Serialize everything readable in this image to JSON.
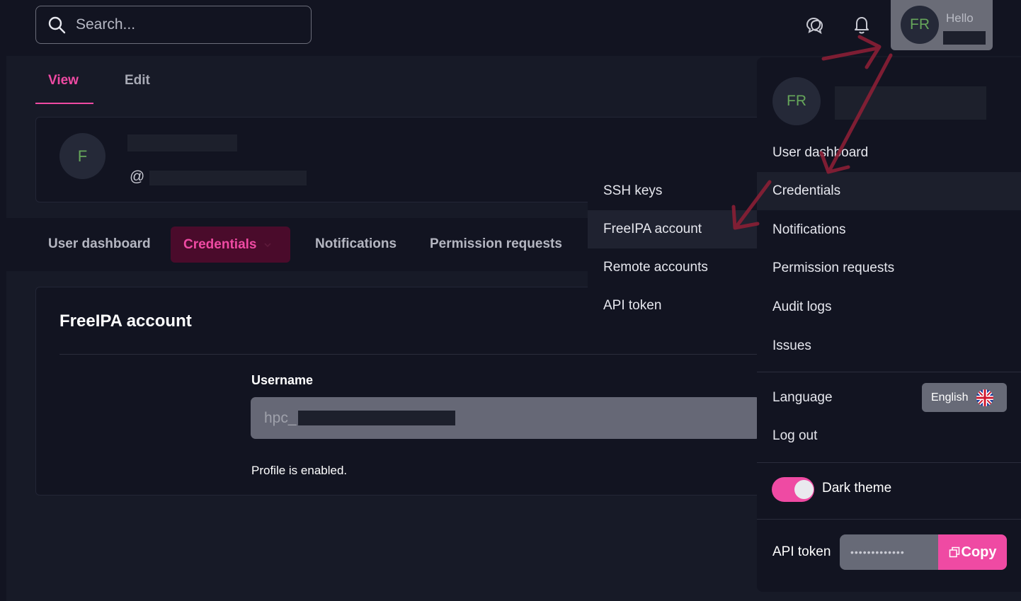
{
  "search": {
    "placeholder": "Search..."
  },
  "header": {
    "hello": "Hello",
    "avatar_initials": "FR"
  },
  "view_tabs": [
    {
      "label": "View",
      "active": true
    },
    {
      "label": "Edit",
      "active": false
    }
  ],
  "profile": {
    "avatar_initial": "F",
    "at_symbol": "@"
  },
  "subnav": [
    {
      "label": "User dashboard"
    },
    {
      "label": "Credentials",
      "active": true
    },
    {
      "label": "Notifications"
    },
    {
      "label": "Permission requests"
    }
  ],
  "submenu": [
    {
      "label": "SSH keys"
    },
    {
      "label": "FreeIPA account",
      "highlighted": true
    },
    {
      "label": "Remote accounts"
    },
    {
      "label": "API token"
    }
  ],
  "content": {
    "title": "FreeIPA account",
    "username_label": "Username",
    "username_prefix": "hpc_",
    "status": "Profile is enabled."
  },
  "dropdown": {
    "avatar_initials": "FR",
    "items": [
      {
        "label": "User dashboard"
      },
      {
        "label": "Credentials",
        "highlighted": true
      },
      {
        "label": "Notifications"
      },
      {
        "label": "Permission requests"
      },
      {
        "label": "Audit logs"
      },
      {
        "label": "Issues"
      }
    ],
    "language_label": "Language",
    "language_value": "English",
    "logout_label": "Log out",
    "theme_label": "Dark theme",
    "theme_on": true,
    "api_token_label": "API token",
    "api_token_mask": "•••••••••••••",
    "copy_label": "Copy"
  },
  "colors": {
    "accent": "#ef4aa3",
    "background": "#121421",
    "avatar_text": "#66a65a"
  }
}
